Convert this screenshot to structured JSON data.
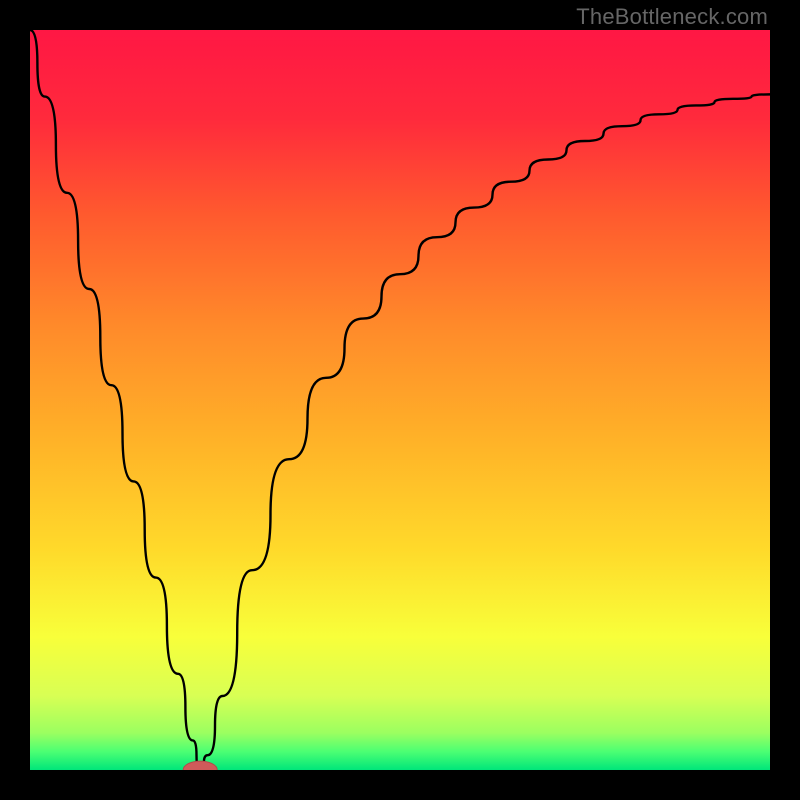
{
  "watermark": {
    "text": "TheBottleneck.com"
  },
  "colors": {
    "black": "#000000",
    "curve": "#000000",
    "marker_fill": "#cf5a5a",
    "marker_stroke": "#b24a4a",
    "gradient_stops": [
      {
        "offset": 0.0,
        "color": "#ff1744"
      },
      {
        "offset": 0.12,
        "color": "#ff2a3c"
      },
      {
        "offset": 0.25,
        "color": "#ff5a2e"
      },
      {
        "offset": 0.4,
        "color": "#ff8a2a"
      },
      {
        "offset": 0.55,
        "color": "#ffb128"
      },
      {
        "offset": 0.7,
        "color": "#ffd92a"
      },
      {
        "offset": 0.82,
        "color": "#f8ff3a"
      },
      {
        "offset": 0.9,
        "color": "#d8ff54"
      },
      {
        "offset": 0.95,
        "color": "#9bff60"
      },
      {
        "offset": 0.975,
        "color": "#4cff73"
      },
      {
        "offset": 1.0,
        "color": "#00e67a"
      }
    ]
  },
  "chart_data": {
    "type": "line",
    "title": "",
    "xlabel": "",
    "ylabel": "",
    "xlim": [
      0,
      100
    ],
    "ylim": [
      0,
      100
    ],
    "grid": false,
    "legend": false,
    "series": [
      {
        "name": "bottleneck-curve",
        "x": [
          0,
          2,
          5,
          8,
          11,
          14,
          17,
          20,
          22,
          23,
          24,
          26,
          30,
          35,
          40,
          45,
          50,
          55,
          60,
          65,
          70,
          75,
          80,
          85,
          90,
          95,
          100
        ],
        "y": [
          100,
          91,
          78,
          65,
          52,
          39,
          26,
          13,
          4,
          0,
          2,
          10,
          27,
          42,
          53,
          61,
          67,
          72,
          76,
          79.5,
          82.5,
          85,
          87,
          88.6,
          89.8,
          90.7,
          91.3
        ]
      }
    ],
    "marker": {
      "x": 23,
      "y": 0,
      "rx": 2.3,
      "ry": 1.2
    }
  }
}
